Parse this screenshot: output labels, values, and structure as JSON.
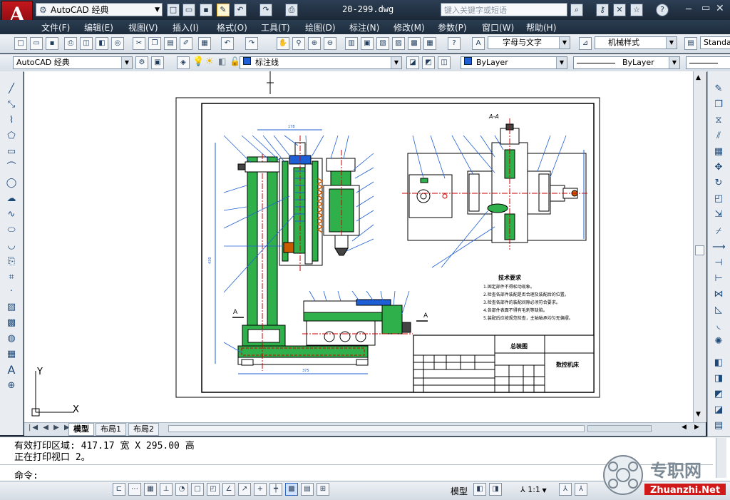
{
  "app": {
    "workspace": "AutoCAD 经典",
    "filename": "20-299.dwg",
    "search_placeholder": "键入关键字或短语"
  },
  "menu": [
    "文件(F)",
    "编辑(E)",
    "视图(V)",
    "插入(I)",
    "格式(O)",
    "工具(T)",
    "绘图(D)",
    "标注(N)",
    "修改(M)",
    "参数(P)",
    "窗口(W)",
    "帮助(H)"
  ],
  "toolbar": {
    "text_style": "字母与文字",
    "table_style": "机械样式",
    "dim_style": "Standa",
    "workspace_combo": "AutoCAD 经典",
    "layer": "标注线",
    "color": "ByLayer",
    "linetype": "ByLayer"
  },
  "drawing": {
    "section_label": "A-A",
    "notes_title": "技术要求",
    "notes": [
      "1.固定部件不得松动现象。",
      "2.检查各部件装配是否合理及装配后的位置。",
      "3.检查各部件的装配间隙必须符合要求。",
      "4.各部件表面不得有毛刺等缺陷。",
      "5.装配后应按规范检查，主轴轴承均匀无偏摆。"
    ],
    "title_block": {
      "part_name": "总装图",
      "company": "数控机床"
    },
    "section_mark": "A",
    "dim_width": "375",
    "dim_top": "178",
    "dim_height": "430"
  },
  "layout_tabs": [
    "模型",
    "布局1",
    "布局2"
  ],
  "command": {
    "line1": "有效打印区域:  417.17 宽 X 295.00 高",
    "line2": "正在打印视口 2。",
    "prompt": "命令:"
  },
  "status": {
    "model_label": "模型",
    "scale": "1:1"
  },
  "watermark": {
    "brand": "专职网",
    "url": "Zhuanzhi.Net"
  },
  "ucs": {
    "x": "X",
    "y": "Y"
  }
}
